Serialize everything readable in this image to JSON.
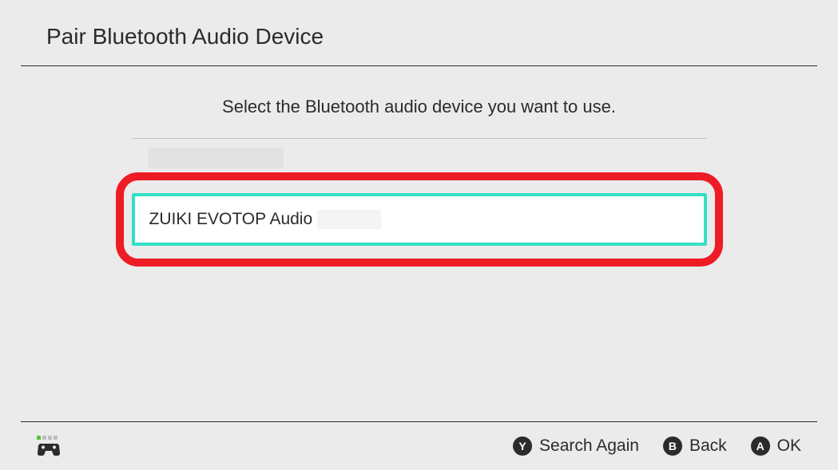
{
  "header": {
    "title": "Pair Bluetooth Audio Device"
  },
  "main": {
    "instruction": "Select the Bluetooth audio device you want to use.",
    "selected_device": "ZUIKI EVOTOP Audio"
  },
  "footer": {
    "actions": {
      "y": {
        "button": "Y",
        "label": "Search Again"
      },
      "b": {
        "button": "B",
        "label": "Back"
      },
      "a": {
        "button": "A",
        "label": "OK"
      }
    }
  }
}
